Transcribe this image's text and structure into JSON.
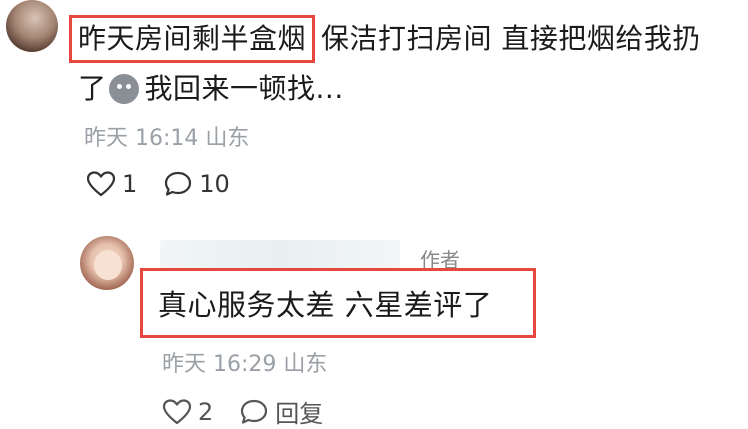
{
  "comment": {
    "highlight": "昨天房间剩半盒烟",
    "text_rest_1": "保洁打扫房间 直接把烟给我扔",
    "text_rest_2a": "了",
    "emoji_icon": "sweat-face-icon",
    "text_rest_2b": "我回来一顿找...",
    "meta": "昨天 16:14 山东",
    "likes": "1",
    "replies": "10"
  },
  "reply": {
    "author_tag": "作者",
    "text": "真心服务太差 六星差评了",
    "meta": "昨天 16:29 山东",
    "likes": "2",
    "reply_label": "回复"
  },
  "colors": {
    "highlight_border": "#e6483d",
    "meta_text": "#9aa0a6"
  }
}
